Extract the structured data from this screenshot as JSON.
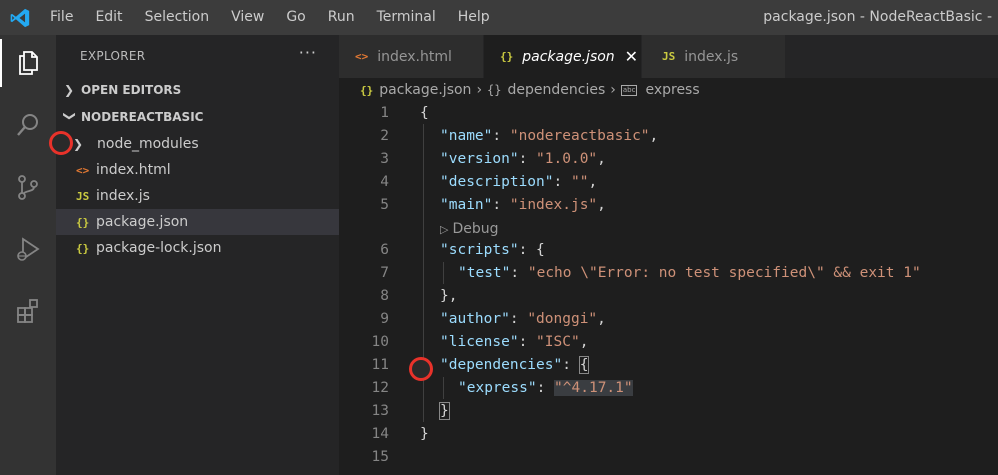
{
  "menu": [
    "File",
    "Edit",
    "Selection",
    "View",
    "Go",
    "Run",
    "Terminal",
    "Help"
  ],
  "window_title": "package.json - NodeReactBasic - ",
  "activity_bar": [
    "files-icon",
    "search-icon",
    "source-control-icon",
    "run-debug-icon",
    "extensions-icon"
  ],
  "explorer": {
    "title": "EXPLORER",
    "more": "···",
    "open_editors": "OPEN EDITORS",
    "project": "NODEREACTBASIC",
    "items": [
      {
        "name": "node_modules",
        "icon": "›",
        "type": "folder"
      },
      {
        "name": "index.html",
        "icon": "<>",
        "type": "html"
      },
      {
        "name": "index.js",
        "icon": "JS",
        "type": "js"
      },
      {
        "name": "package.json",
        "icon": "{}",
        "type": "json"
      },
      {
        "name": "package-lock.json",
        "icon": "{}",
        "type": "json"
      }
    ]
  },
  "tabs": [
    {
      "label": "index.html",
      "icon": "<>"
    },
    {
      "label": "package.json",
      "icon": "{}",
      "close": "✕"
    },
    {
      "label": "index.js",
      "icon": "JS"
    }
  ],
  "breadcrumb": {
    "file_icon": "{}",
    "file": "package.json",
    "sep": "›",
    "node_icon": "{}",
    "node": "dependencies",
    "leaf_icon": "abc",
    "leaf": "express"
  },
  "editor": {
    "line_numbers": [
      "1",
      "2",
      "3",
      "4",
      "5",
      "6",
      "7",
      "8",
      "9",
      "10",
      "11",
      "12",
      "13",
      "14",
      "15"
    ],
    "codelens": "Debug",
    "tokens": {
      "l1_brace": "{",
      "name_key": "\"name\"",
      "name_val": "\"nodereactbasic\"",
      "version_key": "\"version\"",
      "version_val": "\"1.0.0\"",
      "description_key": "\"description\"",
      "description_val": "\"\"",
      "main_key": "\"main\"",
      "main_val": "\"index.js\"",
      "scripts_key": "\"scripts\"",
      "scripts_brace": "{",
      "test_key": "\"test\"",
      "test_val": "\"echo \\\"Error: no test specified\\\" && exit 1\"",
      "scripts_close": "},",
      "author_key": "\"author\"",
      "author_val": "\"donggi\"",
      "license_key": "\"license\"",
      "license_val": "\"ISC\"",
      "dependencies_key": "\"dependencies\"",
      "dependencies_brace": "{",
      "express_key": "\"express\"",
      "express_val": "\"^4.17.1\"",
      "dep_close": "}",
      "l14_brace": "}",
      "colon": ": ",
      "comma": ","
    }
  }
}
